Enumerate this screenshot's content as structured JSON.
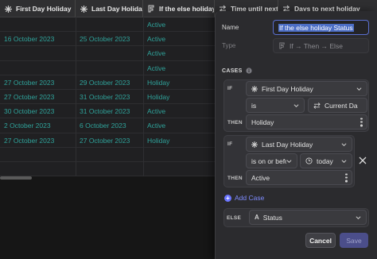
{
  "columns": [
    {
      "label": "First Day Holiday",
      "icon": "sparkle-icon"
    },
    {
      "label": "Last Day Holiday",
      "icon": "sparkle-icon"
    },
    {
      "label": "If the else holiday S",
      "icon": "formula-icon"
    },
    {
      "label": "Time until next",
      "icon": "arrows-icon"
    },
    {
      "label": "Days to next holiday",
      "icon": "arrows-icon"
    }
  ],
  "rows": [
    [
      "",
      "",
      "Active"
    ],
    [
      "16 October 2023",
      "25 October 2023",
      "Active"
    ],
    [
      "",
      "",
      "Active"
    ],
    [
      "",
      "",
      "Active"
    ],
    [
      "27 October 2023",
      "29 October 2023",
      "Holiday"
    ],
    [
      "27 October 2023",
      "31 October 2023",
      "Holiday"
    ],
    [
      "30 October 2023",
      "31 October 2023",
      "Active"
    ],
    [
      "2 October 2023",
      "6 October 2023",
      "Active"
    ],
    [
      "27 October 2023",
      "27 October 2023",
      "Holiday"
    ],
    [
      "",
      "",
      ""
    ],
    [
      "",
      "",
      ""
    ]
  ],
  "panel": {
    "name_label": "Name",
    "name_value": "If the else holiday Status",
    "type_label": "Type",
    "type_value": "If → Then → Else",
    "cases_label": "CASES",
    "case1": {
      "if_tag": "IF",
      "field": "First Day Holiday",
      "operator": "is",
      "compare": "Current Da",
      "then_tag": "THEN",
      "then_value": "Holiday"
    },
    "case2": {
      "if_tag": "IF",
      "field": "Last Day Holiday",
      "operator": "is on or befo",
      "compare": "today",
      "then_tag": "THEN",
      "then_value": "Active"
    },
    "add_case": "Add Case",
    "else_tag": "ELSE",
    "else_value": "Status",
    "cancel": "Cancel",
    "save": "Save"
  },
  "colors": {
    "accent": "#7f8cff",
    "cell_text": "#2fa39b",
    "selection": "#4c6ec5"
  }
}
